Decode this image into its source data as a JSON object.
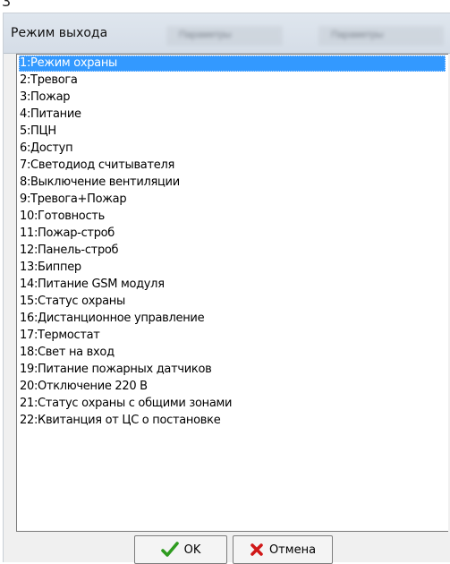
{
  "top_fragment": "3",
  "dialog": {
    "title": "Режим выхода",
    "background_tabs": [
      "Параметры",
      "Параметры"
    ]
  },
  "list": {
    "selected_index": 0,
    "items": [
      "1:Режим охраны",
      "2:Тревога",
      "3:Пожар",
      "4:Питание",
      "5:ПЦН",
      "6:Доступ",
      "7:Светодиод считывателя",
      "8:Выключение вентиляции",
      "9:Тревога+Пожар",
      "10:Готовность",
      "11:Пожар-строб",
      "12:Панель-строб",
      "13:Биппер",
      "14:Питание GSM модуля",
      "15:Статус охраны",
      "16:Дистанционное управление",
      "17:Термостат",
      "18:Свет на вход",
      "19:Питание пожарных датчиков",
      "20:Отключение 220 В",
      "21:Статус охраны с общими зонами",
      "22:Квитанция от ЦС о постановке"
    ]
  },
  "buttons": {
    "ok_label": "OK",
    "ok_icon": "check-icon",
    "cancel_label": "Отмена",
    "cancel_icon": "cross-icon"
  },
  "colors": {
    "selection": "#3399ff",
    "ok_icon": "#2e9b1f",
    "cancel_icon": "#d01818"
  }
}
